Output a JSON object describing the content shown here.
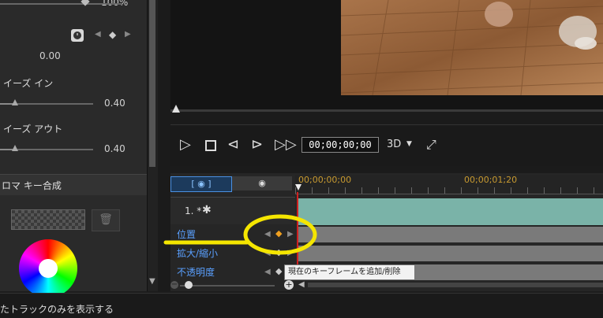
{
  "left_panel": {
    "top_value": "100%",
    "keyframe_value": "0.00",
    "ease_in_label": "イーズ イン",
    "ease_in_value": "0.40",
    "ease_out_label": "イーズ アウト",
    "ease_out_value": "0.40",
    "chroma_key_label": "ロマ キー合成",
    "ease_in_level": 0.16,
    "ease_out_level": 0.16
  },
  "player": {
    "timecode": "00;00;00;00",
    "mode_3d": "3D",
    "progress": 0.0
  },
  "timeline": {
    "ruler_start": "00;00;00;00",
    "ruler_mid": "00;00;01;20",
    "track_name": "1. *",
    "rows": [
      {
        "label": "位置"
      },
      {
        "label": "拡大/縮小"
      },
      {
        "label": "不透明度"
      }
    ],
    "tooltip": "現在のキーフレームを追加/削除"
  },
  "status": {
    "text": "たトラックのみを表示する"
  },
  "colors": {
    "accent_blue": "#5aa0ff",
    "highlight_yellow": "#f5e600",
    "keyframe_orange": "#f0a020",
    "clip_teal": "#7ab3a8",
    "playhead_red": "#d02020"
  }
}
